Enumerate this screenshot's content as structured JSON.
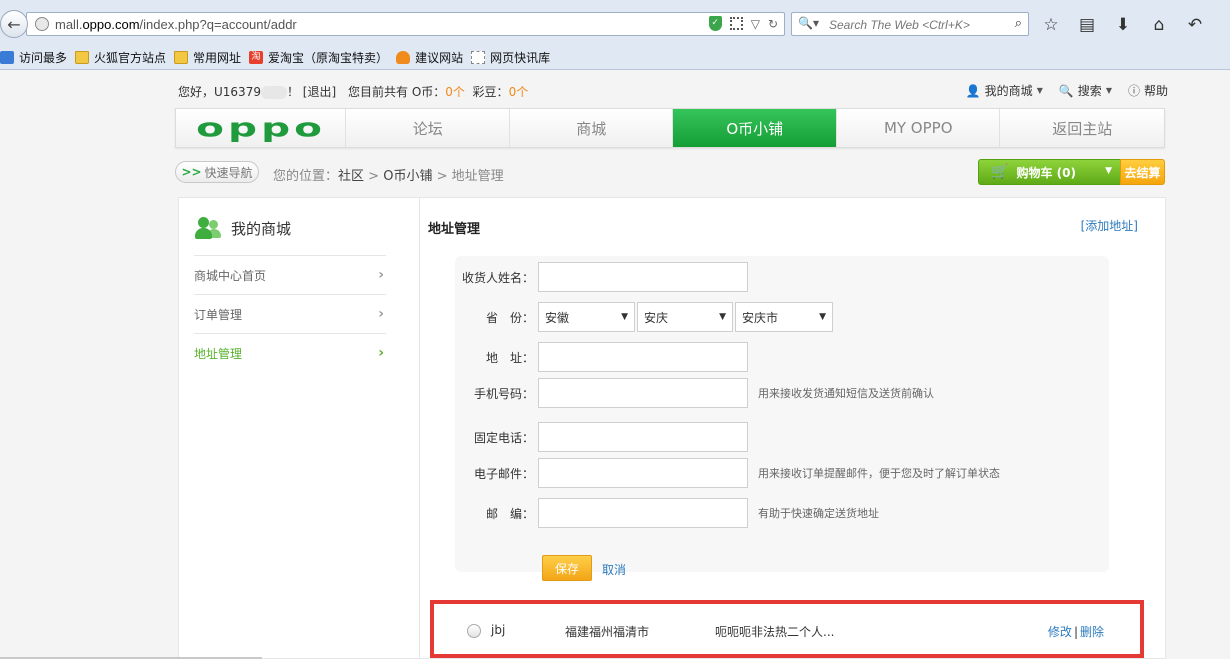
{
  "browser": {
    "url_prefix": "mall.",
    "url_domain": "oppo.com",
    "url_path": "/index.php?q=account/addr",
    "search_placeholder": "Search The Web <Ctrl+K>",
    "bookmarks": [
      "访问最多",
      "火狐官方站点",
      "常用网址",
      "爱淘宝（原淘宝特卖）",
      "建议网站",
      "网页快讯库"
    ]
  },
  "topbar": {
    "greeting_prefix": "您好，U16379",
    "greeting_suffix": "！ [退出]",
    "coins_label": "您目前共有 O币：",
    "coins_value": "0个",
    "beans_label": "彩豆：",
    "beans_value": "0个",
    "my_mall": "我的商城",
    "search": "搜索",
    "help": "帮助"
  },
  "mainnav": {
    "logo": "oppo",
    "items": [
      "论坛",
      "商城",
      "O币小铺",
      "MY OPPO",
      "返回主站"
    ],
    "active_index": 2
  },
  "crumbs": {
    "quick_nav": "快速导航",
    "location_label": "您的位置：",
    "path": [
      "社区",
      "O币小铺",
      "地址管理"
    ],
    "separator": ">",
    "cart_label": "购物车 (0)",
    "checkout_label": "去结算"
  },
  "sidebar": {
    "title": "我的商城",
    "items": [
      "商城中心首页",
      "订单管理",
      "地址管理"
    ],
    "active_index": 2
  },
  "main": {
    "title": "地址管理",
    "add_link": "[添加地址]"
  },
  "form": {
    "name_label": "收货人姓名：",
    "province_label": "省　份：",
    "province_value": "安徽",
    "city_value": "安庆",
    "district_value": "安庆市",
    "address_label": "地　址：",
    "mobile_label": "手机号码：",
    "mobile_hint": "用来接收发货通知短信及送货前确认",
    "phone_label": "固定电话：",
    "email_label": "电子邮件：",
    "email_hint": "用来接收订单提醒邮件，便于您及时了解订单状态",
    "zip_label": "邮　编：",
    "zip_hint": "有助于快速确定送货地址",
    "save": "保存",
    "cancel": "取消"
  },
  "address_list": [
    {
      "name": "jbj",
      "region": "福建福州福清市",
      "street": "呃呃呃非法热二个人...",
      "edit": "修改",
      "separator": "|",
      "delete": "删除"
    }
  ],
  "colors": {
    "brand_green": "#1f9b3d",
    "active_nav": "#159d36",
    "link_blue": "#2e7bbf",
    "accent_orange": "#f08a1c",
    "highlight_red": "#e53935"
  }
}
